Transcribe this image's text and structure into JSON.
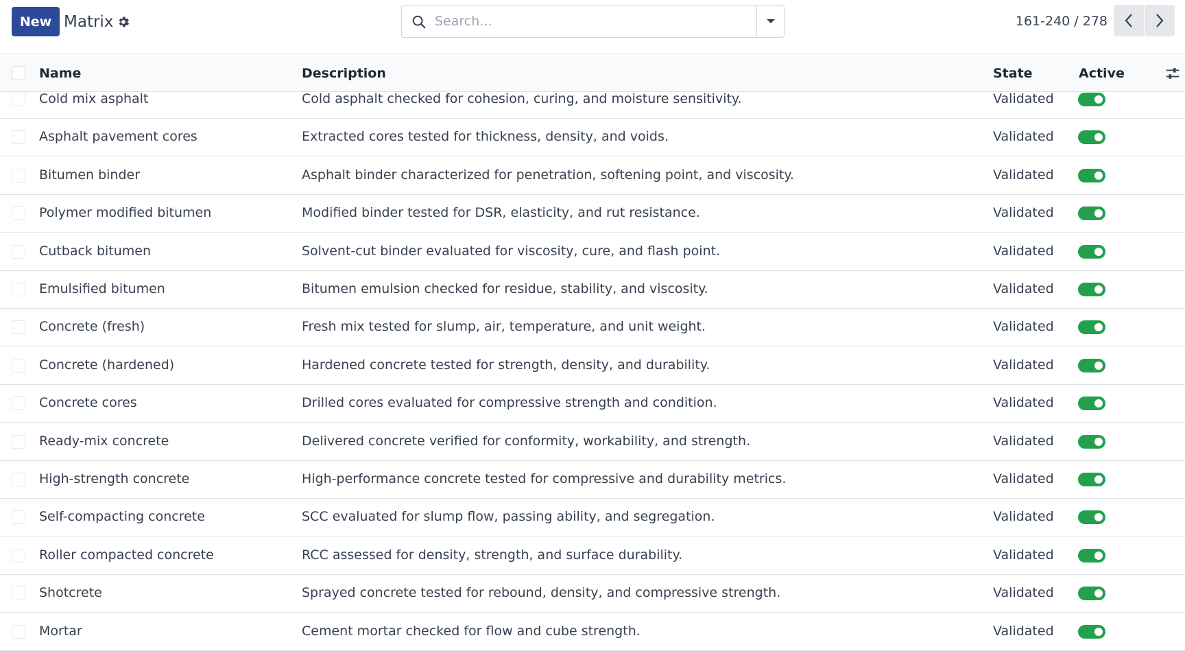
{
  "header": {
    "new_label": "New",
    "title": "Matrix",
    "search_placeholder": "Search...",
    "pager": "161-240 / 278"
  },
  "table": {
    "columns": {
      "name": "Name",
      "description": "Description",
      "state": "State",
      "active": "Active"
    },
    "rows": [
      {
        "name": "Cold mix asphalt",
        "description": "Cold asphalt checked for cohesion, curing, and moisture sensitivity.",
        "state": "Validated",
        "active": true
      },
      {
        "name": "Asphalt pavement cores",
        "description": "Extracted cores tested for thickness, density, and voids.",
        "state": "Validated",
        "active": true
      },
      {
        "name": "Bitumen binder",
        "description": "Asphalt binder characterized for penetration, softening point, and viscosity.",
        "state": "Validated",
        "active": true
      },
      {
        "name": "Polymer modified bitumen",
        "description": "Modified binder tested for DSR, elasticity, and rut resistance.",
        "state": "Validated",
        "active": true
      },
      {
        "name": "Cutback bitumen",
        "description": "Solvent-cut binder evaluated for viscosity, cure, and flash point.",
        "state": "Validated",
        "active": true
      },
      {
        "name": "Emulsified bitumen",
        "description": "Bitumen emulsion checked for residue, stability, and viscosity.",
        "state": "Validated",
        "active": true
      },
      {
        "name": "Concrete (fresh)",
        "description": "Fresh mix tested for slump, air, temperature, and unit weight.",
        "state": "Validated",
        "active": true
      },
      {
        "name": "Concrete (hardened)",
        "description": "Hardened concrete tested for strength, density, and durability.",
        "state": "Validated",
        "active": true
      },
      {
        "name": "Concrete cores",
        "description": "Drilled cores evaluated for compressive strength and condition.",
        "state": "Validated",
        "active": true
      },
      {
        "name": "Ready-mix concrete",
        "description": "Delivered concrete verified for conformity, workability, and strength.",
        "state": "Validated",
        "active": true
      },
      {
        "name": "High-strength concrete",
        "description": "High-performance concrete tested for compressive and durability metrics.",
        "state": "Validated",
        "active": true
      },
      {
        "name": "Self-compacting concrete",
        "description": "SCC evaluated for slump flow, passing ability, and segregation.",
        "state": "Validated",
        "active": true
      },
      {
        "name": "Roller compacted concrete",
        "description": "RCC assessed for density, strength, and surface durability.",
        "state": "Validated",
        "active": true
      },
      {
        "name": "Shotcrete",
        "description": "Sprayed concrete tested for rebound, density, and compressive strength.",
        "state": "Validated",
        "active": true
      },
      {
        "name": "Mortar",
        "description": "Cement mortar checked for flow and cube strength.",
        "state": "Validated",
        "active": true
      }
    ]
  }
}
